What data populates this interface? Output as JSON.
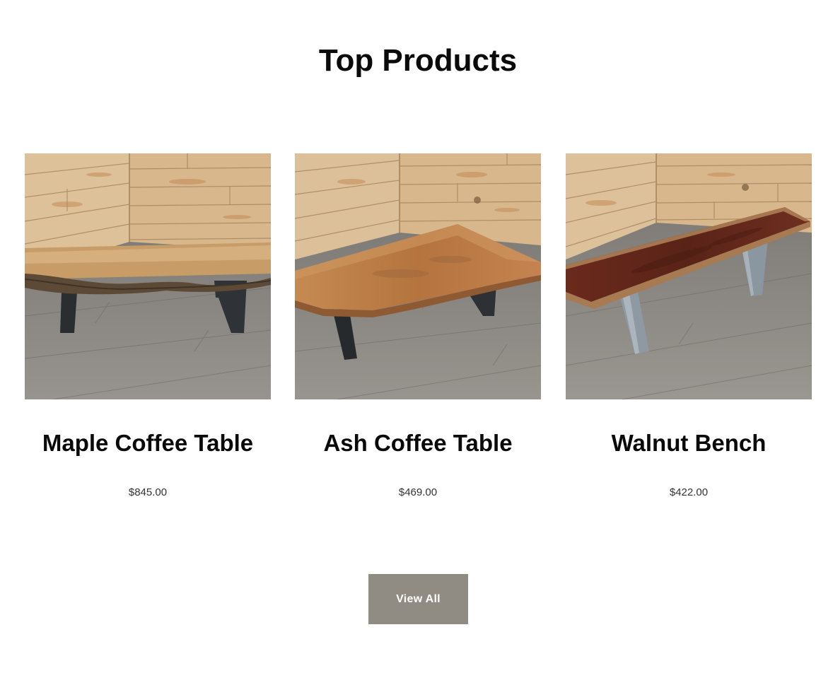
{
  "section": {
    "title": "Top Products"
  },
  "products": [
    {
      "name": "Maple Coffee Table",
      "price": "$845.00",
      "image": "maple-live-edge-coffee-table-photo"
    },
    {
      "name": "Ash Coffee Table",
      "price": "$469.00",
      "image": "ash-live-edge-coffee-table-photo"
    },
    {
      "name": "Walnut Bench",
      "price": "$422.00",
      "image": "walnut-live-edge-bench-photo"
    }
  ],
  "actions": {
    "view_all_label": "View All"
  },
  "colors": {
    "button_bg": "#908c84",
    "button_text": "#ffffff",
    "heading": "#0a0a0a",
    "price": "#333333",
    "wall_wood": "#d9b98f",
    "floor": "#8a8884",
    "maple_top": "#c9a06a",
    "ash_top": "#b4733e",
    "walnut_top": "#5e2418",
    "steel_dark": "#2c2f33",
    "steel_raw": "#8d98a2"
  }
}
